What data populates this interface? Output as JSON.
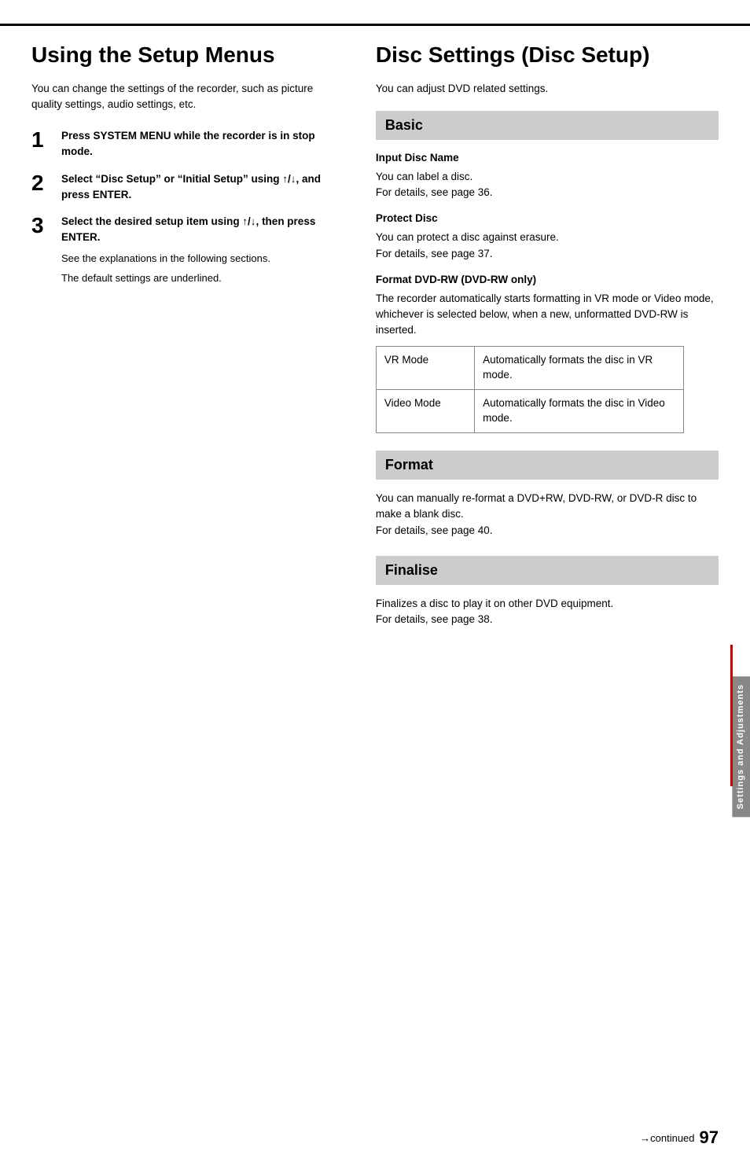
{
  "left": {
    "title": "Using the Setup Menus",
    "intro": "You can change the settings of the recorder, such as picture quality settings, audio settings, etc.",
    "steps": [
      {
        "number": "1",
        "text": "Press SYSTEM MENU while the recorder is in stop mode."
      },
      {
        "number": "2",
        "text": "Select “Disc Setup” or “Initial Setup” using ↑/↓, and press ENTER."
      },
      {
        "number": "3",
        "text": "Select the desired setup item using ↑/↓, then press ENTER.",
        "sub1": "See the explanations in the following sections.",
        "sub2": "The default settings are underlined."
      }
    ]
  },
  "right": {
    "title": "Disc Settings (Disc Setup)",
    "intro": "You can adjust DVD related settings.",
    "sections": [
      {
        "id": "basic",
        "header": "Basic",
        "subsections": [
          {
            "title": "Input Disc Name",
            "body": "You can label a disc.\nFor details, see page 36."
          },
          {
            "title": "Protect Disc",
            "body": "You can protect a disc against erasure.\nFor details, see page 37."
          },
          {
            "title": "Format DVD-RW (DVD-RW only)",
            "body": "The recorder automatically starts formatting in VR mode or Video mode, whichever is selected below, when a new, unformatted DVD-RW is inserted.",
            "table": [
              {
                "mode": "VR Mode",
                "desc": "Automatically formats the disc in VR mode."
              },
              {
                "mode": "Video Mode",
                "desc": "Automatically formats the disc in Video mode."
              }
            ]
          }
        ]
      },
      {
        "id": "format",
        "header": "Format",
        "subsections": [
          {
            "title": "",
            "body": "You can manually re-format a DVD+RW, DVD-RW, or DVD-R disc to make a blank disc.\nFor details, see page 40."
          }
        ]
      },
      {
        "id": "finalise",
        "header": "Finalise",
        "subsections": [
          {
            "title": "",
            "body": "Finalizes a disc to play it on other DVD equipment.\nFor details, see page 38."
          }
        ]
      }
    ]
  },
  "sideTab": "Settings and Adjustments",
  "footer": {
    "continued": "→continued",
    "pageNumber": "97"
  }
}
